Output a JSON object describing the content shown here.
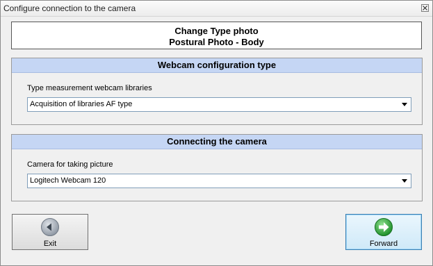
{
  "window": {
    "title": "Configure connection to the camera"
  },
  "header": {
    "line1": "Change Type photo",
    "line2": "Postural Photo - Body"
  },
  "webcam_config": {
    "title": "Webcam configuration type",
    "label": "Type measurement webcam libraries",
    "selected": "Acquisition of libraries AF type"
  },
  "camera_connection": {
    "title": "Connecting the camera",
    "label": "Camera for taking picture",
    "selected": "Logitech Webcam 120"
  },
  "buttons": {
    "exit_label": "Exit",
    "forward_label": "Forward"
  },
  "icons": {
    "close": "close-icon",
    "back": "back-arrow-icon",
    "forward": "forward-arrow-icon",
    "dropdown": "chevron-down-icon"
  },
  "colors": {
    "group_header": "#c5d6f4",
    "forward_icon": "#2fa83a",
    "back_icon": "#8f98a4"
  }
}
